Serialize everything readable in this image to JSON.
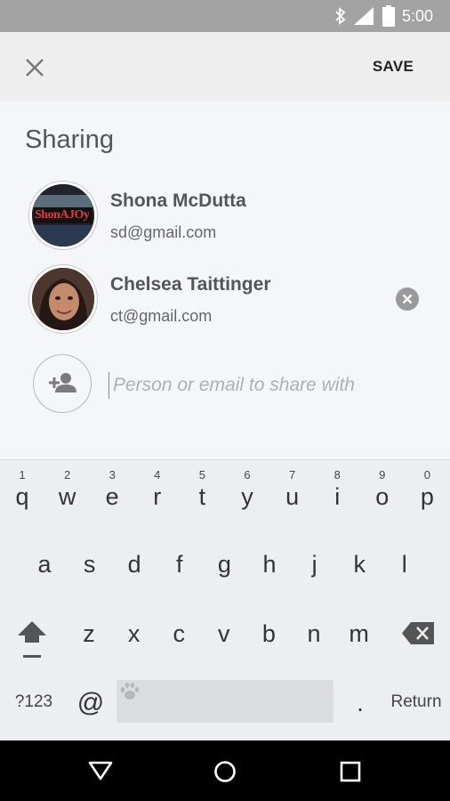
{
  "status_bar": {
    "time": "5:00",
    "icons": [
      "bluetooth-icon",
      "signal-icon",
      "battery-icon"
    ]
  },
  "toolbar": {
    "close_icon": "close-icon",
    "save_label": "SAVE"
  },
  "sharing": {
    "title": "Sharing",
    "people": [
      {
        "name": "Shona McDutta",
        "email": "sd@gmail.com",
        "avatar_text": "ShonAJOy",
        "removable": false
      },
      {
        "name": "Chelsea Taittinger",
        "email": "ct@gmail.com",
        "removable": true
      }
    ],
    "add_input": {
      "placeholder": "Person or email to share with",
      "value": ""
    }
  },
  "keyboard": {
    "row1": [
      {
        "k": "q",
        "h": "1"
      },
      {
        "k": "w",
        "h": "2"
      },
      {
        "k": "e",
        "h": "3"
      },
      {
        "k": "r",
        "h": "4"
      },
      {
        "k": "t",
        "h": "5"
      },
      {
        "k": "y",
        "h": "6"
      },
      {
        "k": "u",
        "h": "7"
      },
      {
        "k": "i",
        "h": "8"
      },
      {
        "k": "o",
        "h": "9"
      },
      {
        "k": "p",
        "h": "0"
      }
    ],
    "row2": [
      "a",
      "s",
      "d",
      "f",
      "g",
      "h",
      "j",
      "k",
      "l"
    ],
    "row3": [
      "z",
      "x",
      "c",
      "v",
      "b",
      "n",
      "m"
    ],
    "symbols_label": "?123",
    "at_label": "@",
    "period_label": ".",
    "return_label": "Return"
  },
  "colors": {
    "status_bar": "#a3a3a3",
    "toolbar": "#eeeeee",
    "keyboard": "#eceff1",
    "nav_bar": "#000000"
  }
}
